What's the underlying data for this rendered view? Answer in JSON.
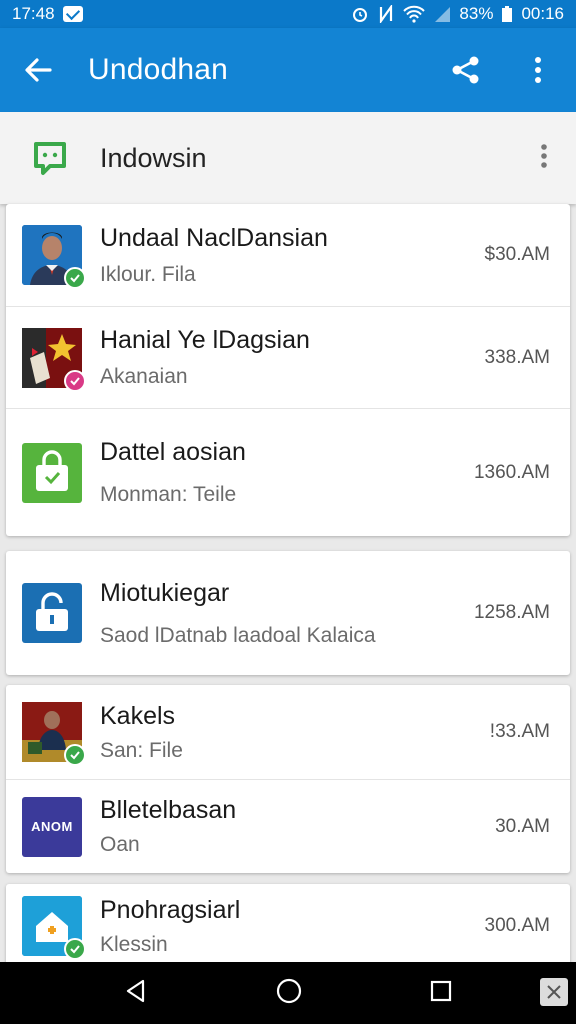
{
  "status_bar": {
    "time": "17:48",
    "battery": "83%",
    "clock": "00:16"
  },
  "app_bar": {
    "title": "Undodhan"
  },
  "section": {
    "title": "Indowsin"
  },
  "items": [
    {
      "name": "Undaal NaclDansian",
      "subtitle": "Iklour. Fila",
      "time": "$30.AM",
      "thumb": "portrait-man-suit",
      "badge": "check-green"
    },
    {
      "name": "Hanial Ye lDagsian",
      "subtitle": "Akanaian",
      "time": "338.AM",
      "thumb": "red-star-poster",
      "badge": "check-pink"
    },
    {
      "name": "Dattel aosian",
      "subtitle": "Monman: Teile",
      "time": "1360.AM",
      "thumb": "green-bag-icon"
    },
    {
      "name": "Miotukiegar",
      "subtitle": "Saod lDatnab laadoal Kalaica",
      "time": "1258.AM",
      "thumb": "blue-lock-icon"
    },
    {
      "name": "Kakels",
      "subtitle": "San: File",
      "time": "!33.AM",
      "thumb": "man-podium",
      "badge": "check-green"
    },
    {
      "name": "Blletelbasan",
      "subtitle": "Oan",
      "time": "30.AM",
      "thumb": "anom-logo",
      "thumb_text": "ANOM"
    },
    {
      "name": "Pnohragsiarl",
      "subtitle": "Klessin",
      "time": "300.AM",
      "thumb": "home-plus-icon",
      "badge": "check-green"
    }
  ]
}
